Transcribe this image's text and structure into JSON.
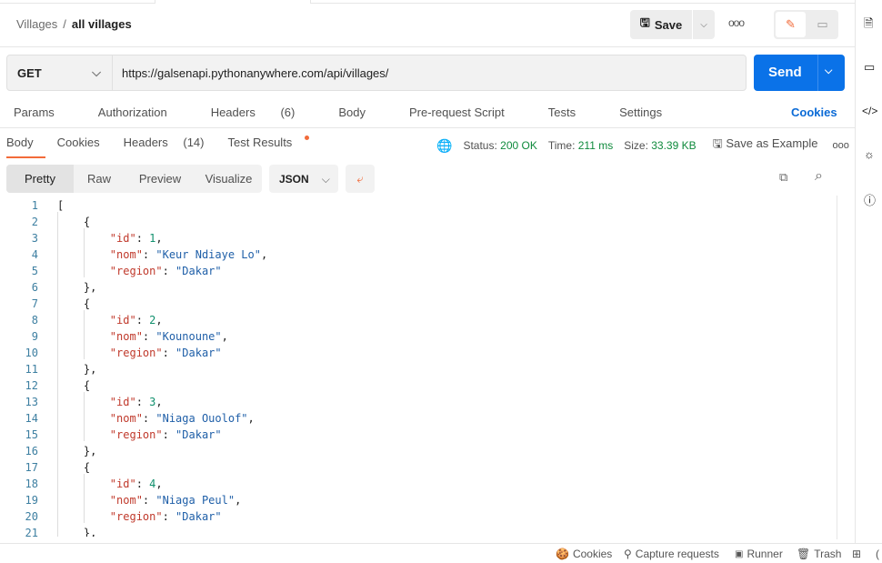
{
  "breadcrumb": {
    "collection": "Villages",
    "separator": "/",
    "request": "all villages"
  },
  "toolbar": {
    "save_label": "Save",
    "more": "ooo"
  },
  "request": {
    "method": "GET",
    "url": "https://galsenapi.pythonanywhere.com/api/villages/",
    "send_label": "Send"
  },
  "request_tabs": [
    {
      "label": "Params"
    },
    {
      "label": "Authorization"
    },
    {
      "label": "Headers",
      "count": "(6)"
    },
    {
      "label": "Body"
    },
    {
      "label": "Pre-request Script"
    },
    {
      "label": "Tests"
    },
    {
      "label": "Settings"
    }
  ],
  "cookies_link": "Cookies",
  "response_tabs": [
    {
      "label": "Body"
    },
    {
      "label": "Cookies"
    },
    {
      "label": "Headers",
      "count": "(14)"
    },
    {
      "label": "Test Results"
    }
  ],
  "response_status": {
    "status_label": "Status:",
    "status": "200 OK",
    "time_label": "Time:",
    "time": "211 ms",
    "size_label": "Size:",
    "size": "33.39 KB",
    "save_example": "Save as Example"
  },
  "view_modes": [
    "Pretty",
    "Raw",
    "Preview",
    "Visualize"
  ],
  "format": "JSON",
  "response_body": [
    {
      "id": 1,
      "nom": "Keur Ndiaye Lo",
      "region": "Dakar"
    },
    {
      "id": 2,
      "nom": "Kounoune",
      "region": "Dakar"
    },
    {
      "id": 3,
      "nom": "Niaga Ouolof",
      "region": "Dakar"
    },
    {
      "id": 4,
      "nom": "Niaga Peul",
      "region": "Dakar"
    }
  ],
  "footer": {
    "cookies": "Cookies",
    "capture": "Capture requests",
    "runner": "Runner",
    "trash": "Trash"
  },
  "colors": {
    "accent": "#f26b3a",
    "send": "#0a72e8",
    "success": "#0f8a3c",
    "link": "#0a6ad6"
  }
}
